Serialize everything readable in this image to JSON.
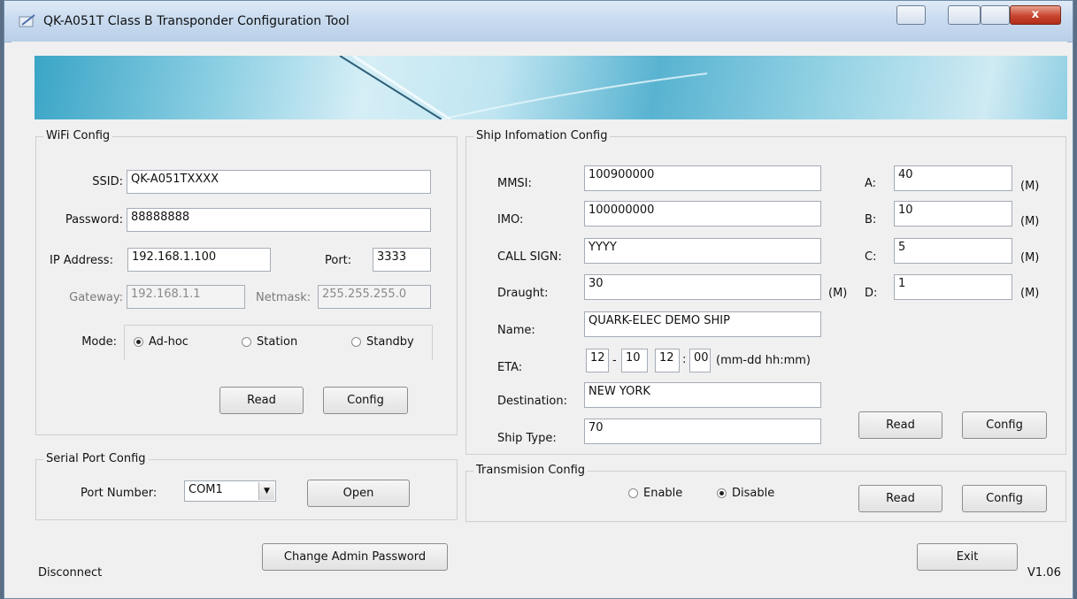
{
  "window": {
    "title": "QK-A051T Class B Transponder Configuration Tool"
  },
  "wifi": {
    "legend": "WiFi Config",
    "ssid_label": "SSID:",
    "ssid_value": "QK-A051TXXXX",
    "password_label": "Password:",
    "password_value": "88888888",
    "ip_label": "IP Address:",
    "ip_value": "192.168.1.100",
    "port_label": "Port:",
    "port_value": "3333",
    "gateway_label": "Gateway:",
    "gateway_value": "192.168.1.1",
    "netmask_label": "Netmask:",
    "netmask_value": "255.255.255.0",
    "mode_label": "Mode:",
    "mode_options": [
      "Ad-hoc",
      "Station",
      "Standby"
    ],
    "mode_selected": "Ad-hoc",
    "read_label": "Read",
    "config_label": "Config"
  },
  "serial": {
    "legend": "Serial Port Config",
    "port_label": "Port Number:",
    "port_value": "COM1",
    "open_label": "Open"
  },
  "ship": {
    "legend": "Ship Infomation Config",
    "mmsi_label": "MMSI:",
    "mmsi_value": "100900000",
    "imo_label": "IMO:",
    "imo_value": "100000000",
    "callsign_label": "CALL SIGN:",
    "callsign_value": "YYYY",
    "draught_label": "Draught:",
    "draught_value": "30",
    "draught_unit": "(M)",
    "name_label": "Name:",
    "name_value": "QUARK-ELEC DEMO SHIP",
    "eta_label": "ETA:",
    "eta_month": "12",
    "eta_dash": "-",
    "eta_day": "10",
    "eta_hour": "12",
    "eta_colon": ":",
    "eta_min": "00",
    "eta_format": "(mm-dd hh:mm)",
    "dest_label": "Destination:",
    "dest_value": "NEW YORK",
    "type_label": "Ship Type:",
    "type_value": "70",
    "a_label": "A:",
    "a_value": "40",
    "b_label": "B:",
    "b_value": "10",
    "c_label": "C:",
    "c_value": "5",
    "d_label": "D:",
    "d_value": "1",
    "unit": "(M)",
    "read_label": "Read",
    "config_label": "Config"
  },
  "transmission": {
    "legend": "Transmision Config",
    "options": [
      "Enable",
      "Disable"
    ],
    "selected": "Disable",
    "read_label": "Read",
    "config_label": "Config"
  },
  "footer": {
    "status": "Disconnect",
    "change_pw_label": "Change Admin Password",
    "exit_label": "Exit",
    "version": "V1.06"
  }
}
